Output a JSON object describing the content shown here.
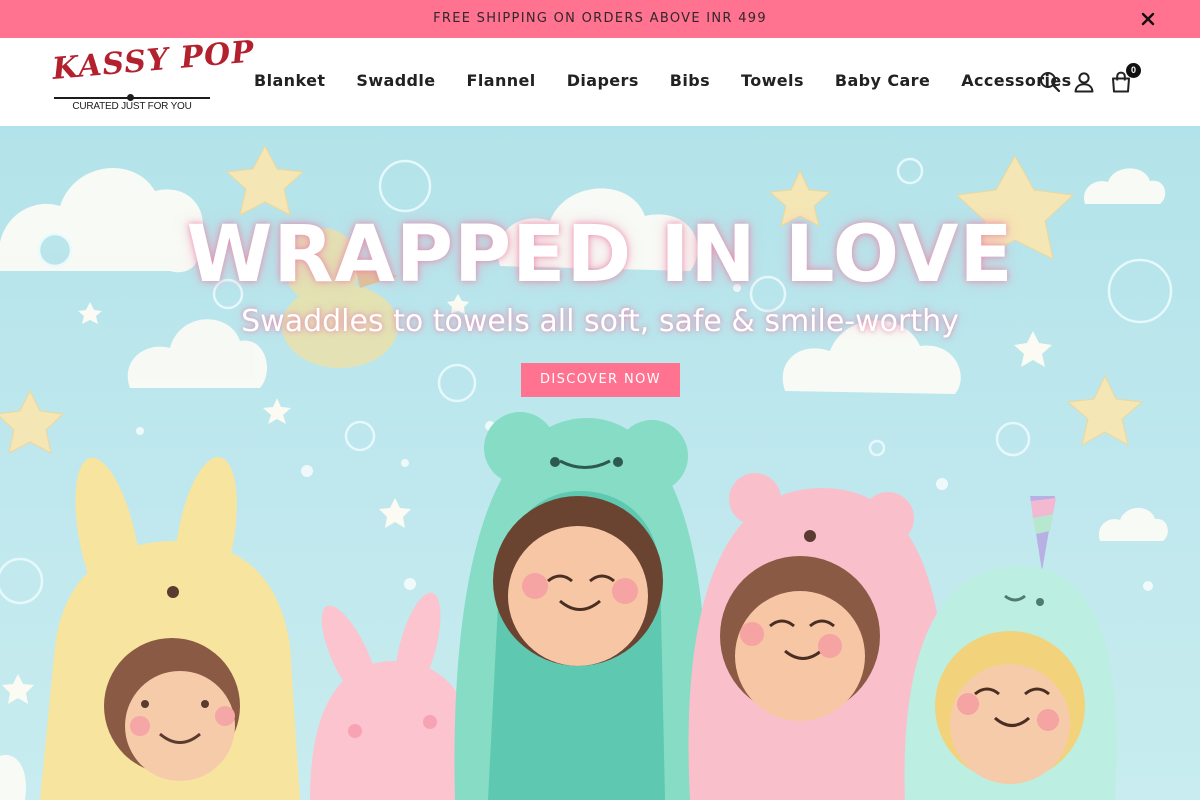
{
  "announcement": {
    "text": "FREE SHIPPING ON ORDERS ABOVE INR 499",
    "close_icon": "close-icon"
  },
  "logo": {
    "wordmark": "KASSY POP",
    "tagline": "CURATED JUST FOR YOU",
    "color": "#b3202e"
  },
  "nav": {
    "items": [
      {
        "label": "Blanket"
      },
      {
        "label": "Swaddle"
      },
      {
        "label": "Flannel"
      },
      {
        "label": "Diapers"
      },
      {
        "label": "Bibs"
      },
      {
        "label": "Towels"
      },
      {
        "label": "Baby Care"
      },
      {
        "label": "Accessories"
      }
    ]
  },
  "header_icons": {
    "search": "search-icon",
    "account": "user-icon",
    "cart": "shopping-bag-icon",
    "cart_count": "0"
  },
  "hero": {
    "title": "WRAPPED IN LOVE",
    "subtitle": "Swaddles to towels all soft, safe & smile-worthy",
    "cta_label": "DISCOVER NOW"
  },
  "colors": {
    "accent": "#ff7390",
    "hero_background": "#b3e3ea"
  }
}
